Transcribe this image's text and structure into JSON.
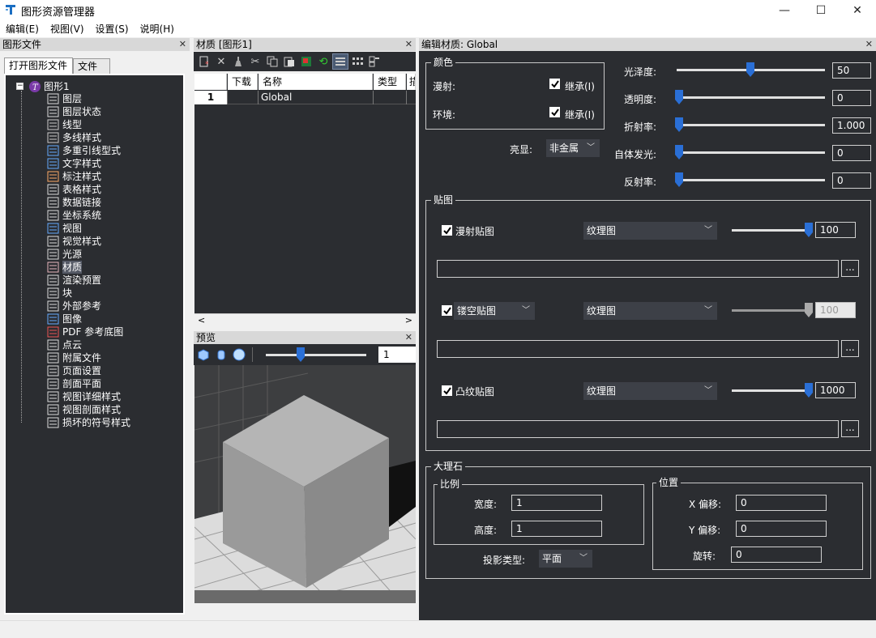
{
  "window": {
    "title": "图形资源管理器",
    "minimize": "—",
    "maximize": "☐",
    "close": "✕"
  },
  "menu": [
    "编辑(E)",
    "视图(V)",
    "设置(S)",
    "说明(H)"
  ],
  "left": {
    "header": "图形文件",
    "close": "✕",
    "tabs": [
      "打开图形文件",
      "文件夹"
    ],
    "tree_root": "图形1",
    "tree_items": [
      {
        "label": "图层",
        "icon": "layer-icon"
      },
      {
        "label": "图层状态",
        "icon": "layer-state-icon"
      },
      {
        "label": "线型",
        "icon": "linetype-icon"
      },
      {
        "label": "多线样式",
        "icon": "mline-style-icon"
      },
      {
        "label": "多重引线型式",
        "icon": "mleader-style-icon"
      },
      {
        "label": "文字样式",
        "icon": "text-style-icon"
      },
      {
        "label": "标注样式",
        "icon": "dim-style-icon"
      },
      {
        "label": "表格样式",
        "icon": "table-style-icon"
      },
      {
        "label": "数据链接",
        "icon": "data-link-icon"
      },
      {
        "label": "坐标系统",
        "icon": "ucs-icon"
      },
      {
        "label": "视图",
        "icon": "view-icon"
      },
      {
        "label": "视觉样式",
        "icon": "visual-style-icon"
      },
      {
        "label": "光源",
        "icon": "light-icon"
      },
      {
        "label": "材质",
        "icon": "material-icon"
      },
      {
        "label": "渲染预置",
        "icon": "render-preset-icon"
      },
      {
        "label": "块",
        "icon": "block-icon"
      },
      {
        "label": "外部参考",
        "icon": "xref-icon"
      },
      {
        "label": "图像",
        "icon": "image-icon"
      },
      {
        "label": "PDF 参考底图",
        "icon": "pdf-icon"
      },
      {
        "label": "点云",
        "icon": "point-cloud-icon"
      },
      {
        "label": "附属文件",
        "icon": "attached-file-icon"
      },
      {
        "label": "页面设置",
        "icon": "page-setup-icon"
      },
      {
        "label": "剖面平面",
        "icon": "section-plane-icon"
      },
      {
        "label": "视图详细样式",
        "icon": "detail-view-style-icon"
      },
      {
        "label": "视图剖面样式",
        "icon": "section-view-style-icon"
      },
      {
        "label": "损坏的符号样式",
        "icon": "broken-symbol-style-icon"
      }
    ]
  },
  "materials": {
    "header": "材质 [图形1]",
    "close": "✕",
    "columns": [
      "",
      "下载",
      "名称",
      "类型",
      "描"
    ],
    "rows": [
      {
        "index": "1",
        "download": "",
        "name": "Global",
        "type": ""
      }
    ],
    "scroll_left": "<",
    "scroll_right": ">"
  },
  "preview": {
    "header": "预览",
    "close": "✕",
    "value": "1"
  },
  "editor": {
    "header": "编辑材质:  Global",
    "close": "✕",
    "color_group": "颜色",
    "diffuse_label": "漫射:",
    "ambient_label": "环境:",
    "inherit_label": "继承(I)",
    "highlight_label": "亮显:",
    "highlight_value": "非金属",
    "props": [
      {
        "label": "光泽度:",
        "value": "50",
        "fraction": 0.5
      },
      {
        "label": "透明度:",
        "value": "0",
        "fraction": 0
      },
      {
        "label": "折射率:",
        "value": "1.000",
        "fraction": 0
      },
      {
        "label": "自体发光:",
        "value": "0",
        "fraction": 0
      },
      {
        "label": "反射率:",
        "value": "0",
        "fraction": 0
      }
    ],
    "maps_group": "贴图",
    "maps": [
      {
        "label": "漫射贴图",
        "type": "纹理图",
        "value": "100",
        "fraction": 1.0,
        "path": "",
        "enabled": true
      },
      {
        "label": "镂空贴图",
        "type": "纹理图",
        "value": "100",
        "fraction": 1.0,
        "path": "",
        "enabled": false
      },
      {
        "label": "凸纹贴图",
        "type": "纹理图",
        "value": "1000",
        "fraction": 1.0,
        "path": "",
        "enabled": true
      }
    ],
    "browse": "...",
    "marble_group": "大理石",
    "scale_group": "比例",
    "width_label": "宽度:",
    "width_value": "1",
    "height_label": "高度:",
    "height_value": "1",
    "position_group": "位置",
    "x_offset_label": "X 偏移:",
    "x_offset_value": "0",
    "y_offset_label": "Y 偏移:",
    "y_offset_value": "0",
    "rotation_label": "旋转:",
    "rotation_value": "0",
    "projection_label": "投影类型:",
    "projection_value": "平面"
  },
  "colors": {
    "panel_bg": "#2b2d31",
    "accent": "#2a6fd6",
    "header_bg": "#d8d8d8"
  }
}
